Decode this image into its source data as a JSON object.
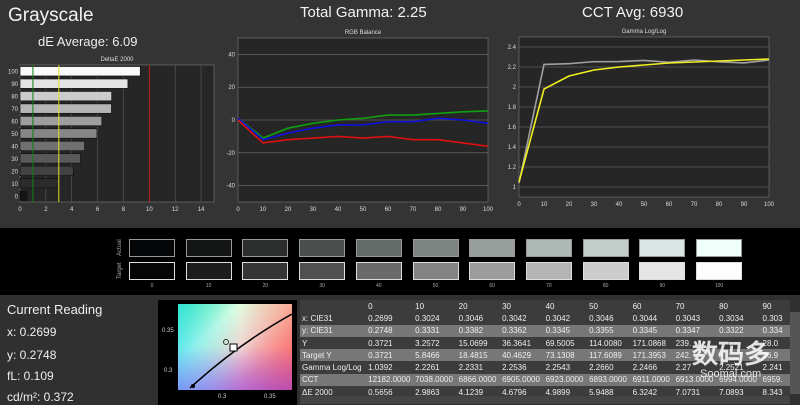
{
  "header": {
    "title": "Grayscale",
    "de_average": "dE Average: 6.09",
    "total_gamma": "Total Gamma: 2.25",
    "cct_avg": "CCT Avg: 6930"
  },
  "colors": {
    "background": "#333333",
    "red": "#e01010",
    "green": "#10a010",
    "blue": "#1010e0",
    "yellow": "#f0f020",
    "target_gray": "#a0a0a0"
  },
  "chart_data": [
    {
      "type": "bar",
      "title": "DeltaE 2000",
      "orientation": "horizontal",
      "categories": [
        "0",
        "10",
        "20",
        "30",
        "40",
        "50",
        "60",
        "70",
        "80",
        "90",
        "100"
      ],
      "values": [
        0.5656,
        2.9863,
        4.1239,
        4.6796,
        4.9899,
        5.9488,
        6.3242,
        7.0731,
        7.0893,
        8.343,
        9.3
      ],
      "xlim": [
        0,
        15
      ],
      "xticks": [
        "0",
        "2",
        "4",
        "6",
        "8",
        "10",
        "12",
        "14"
      ],
      "threshold_lines": [
        {
          "value": 1,
          "color": "#108010"
        },
        {
          "value": 3,
          "color": "#e0e020"
        },
        {
          "value": 10,
          "color": "#c02020"
        }
      ]
    },
    {
      "type": "line",
      "title": "RGB Balance",
      "x": [
        0,
        10,
        20,
        30,
        40,
        50,
        60,
        70,
        80,
        90,
        100
      ],
      "ylim": [
        -50,
        50
      ],
      "yticks": [
        "40",
        "20",
        "0",
        "-20",
        "-40"
      ],
      "xticks": [
        "0",
        "10",
        "20",
        "30",
        "40",
        "50",
        "60",
        "70",
        "80",
        "90",
        "100"
      ],
      "series": [
        {
          "color": "#10a010",
          "values": [
            1,
            -11,
            -5,
            -2,
            0,
            1,
            3,
            3,
            4,
            5,
            5.5
          ]
        },
        {
          "color": "#1010e0",
          "values": [
            1,
            -12,
            -8,
            -5,
            -3,
            -3,
            -1,
            -1,
            1,
            0,
            -2
          ]
        },
        {
          "color": "#e01010",
          "values": [
            0,
            -14,
            -12,
            -11,
            -10,
            -11,
            -10,
            -12,
            -12,
            -14,
            -16
          ]
        }
      ]
    },
    {
      "type": "line",
      "title": "Gamma Log/Log",
      "x": [
        0,
        10,
        20,
        30,
        40,
        50,
        60,
        70,
        80,
        90,
        100
      ],
      "ylim": [
        0.9,
        2.5
      ],
      "yticks": [
        "2.4",
        "2.2",
        "2",
        "1.8",
        "1.6",
        "1.4",
        "1.2",
        "1"
      ],
      "xticks": [
        "0",
        "10",
        "20",
        "30",
        "40",
        "50",
        "60",
        "70",
        "80",
        "90",
        "100"
      ],
      "series": [
        {
          "color": "#a0a0a0",
          "values": [
            1.0392,
            2.2261,
            2.2331,
            2.2536,
            2.2543,
            2.266,
            2.2466,
            2.27,
            2.2521,
            2.241,
            2.27
          ]
        },
        {
          "color": "#f0f020",
          "values": [
            1.05,
            1.98,
            2.11,
            2.17,
            2.2,
            2.22,
            2.24,
            2.25,
            2.26,
            2.27,
            2.28
          ]
        }
      ]
    }
  ],
  "swatches": {
    "row_labels": [
      "Actual",
      "Target"
    ],
    "labels": [
      "0",
      "10",
      "20",
      "30",
      "40",
      "50",
      "60",
      "70",
      "80",
      "90",
      "100"
    ],
    "actual": [
      "#050607",
      "#141616",
      "#2b2e2c",
      "#4a4f4d",
      "#646b68",
      "#7d8482",
      "#979e9b",
      "#aeb8b4",
      "#c3cdca",
      "#dae6e3",
      "#effffa"
    ],
    "target": [
      "#050505",
      "#1c1c1c",
      "#353535",
      "#505050",
      "#6a6a6a",
      "#838383",
      "#9c9c9c",
      "#b4b4b4",
      "#cccccc",
      "#e5e5e5",
      "#fdfdfd"
    ]
  },
  "current_reading": {
    "title": "Current Reading",
    "x": "x: 0.2699",
    "y": "y: 0.2748",
    "fl": "fL: 0.109",
    "cdm2": "cd/m²: 0.372",
    "cie_ticks_x": [
      "0.3",
      "0.35"
    ],
    "cie_ticks_y": [
      "0.35",
      "0.3"
    ]
  },
  "table": {
    "columns": [
      "",
      "0",
      "10",
      "20",
      "30",
      "40",
      "50",
      "60",
      "70",
      "80",
      "90"
    ],
    "rows": [
      [
        "x: CIE31",
        "0.2699",
        "0.3024",
        "0.3046",
        "0.3042",
        "0.3042",
        "0.3046",
        "0.3044",
        "0.3043",
        "0.3034",
        "0.303"
      ],
      [
        "y: CIE31",
        "0.2748",
        "0.3331",
        "0.3382",
        "0.3362",
        "0.3345",
        "0.3355",
        "0.3345",
        "0.3347",
        "0.3322",
        "0.334"
      ],
      [
        "Y",
        "0.3721",
        "3.2572",
        "15.0699",
        "36.3641",
        "69.5005",
        "114.0080",
        "171.0868",
        "239.",
        "",
        "28.0"
      ],
      [
        "Target Y",
        "0.3721",
        "5.8466",
        "18.4815",
        "40.4629",
        "73.1308",
        "117.6089",
        "171.3953",
        "242.",
        "",
        "26.9"
      ],
      [
        "Gamma Log/Log",
        "1.0392",
        "2.2261",
        "2.2331",
        "2.2536",
        "2.2543",
        "2.2660",
        "2.2466",
        "2.27",
        "2.2521",
        "2.241"
      ],
      [
        "CCT",
        "12182.0000",
        "7038.0000",
        "6866.0000",
        "6905.0000",
        "6923.0000",
        "6893.0000",
        "6911.0000",
        "6913.0000",
        "6994.0000",
        "6959."
      ],
      [
        "ΔE 2000",
        "0.5656",
        "2.9863",
        "4.1239",
        "4.6796",
        "4.9899",
        "5.9488",
        "6.3242",
        "7.0731",
        "7.0893",
        "8.343"
      ]
    ]
  },
  "watermark": {
    "text": "数码多",
    "sub": "Soomal.com"
  }
}
